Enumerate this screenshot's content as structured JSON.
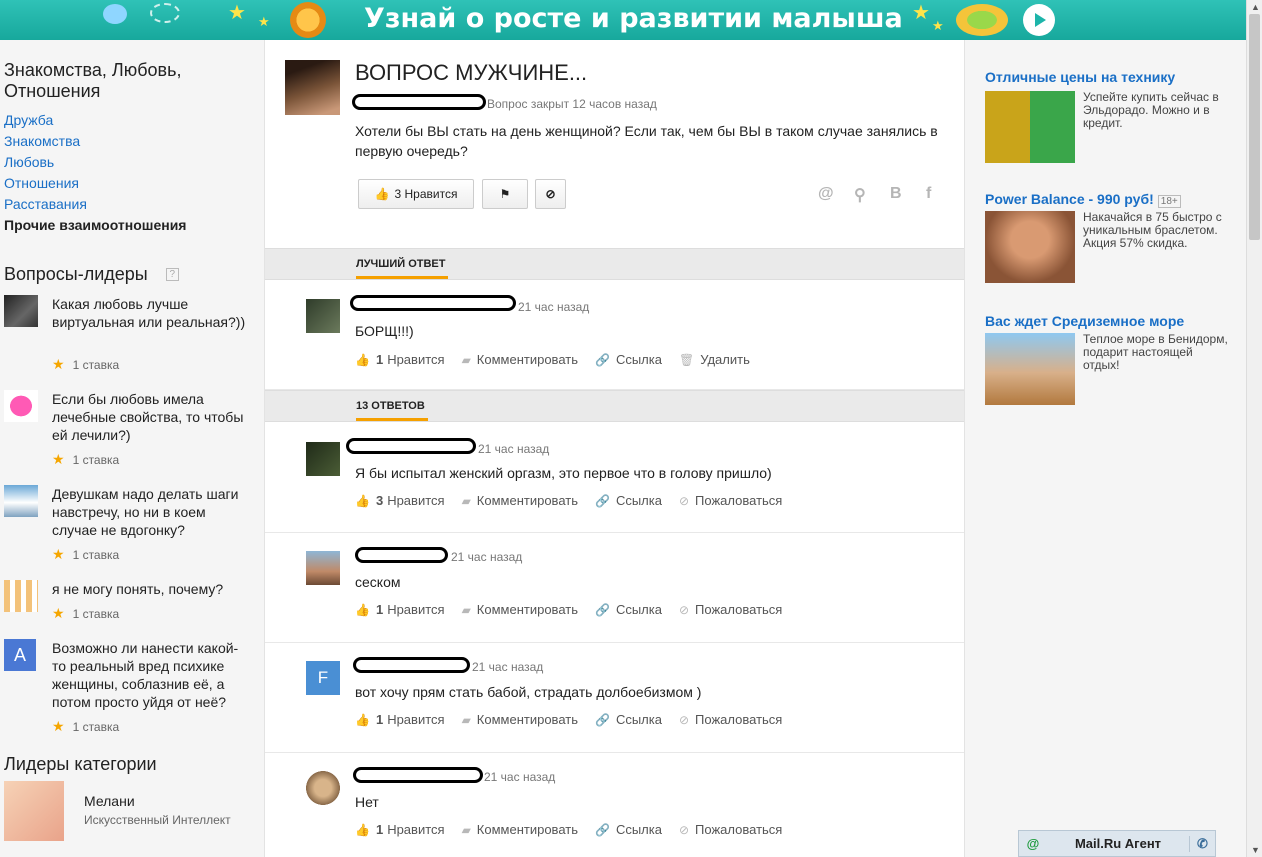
{
  "banner": {
    "title": "Узнай о росте и развитии малыша"
  },
  "sidebar": {
    "category_title": "Знакомства, Любовь, Отношения",
    "links": [
      {
        "label": "Дружба"
      },
      {
        "label": "Знакомства"
      },
      {
        "label": "Любовь"
      },
      {
        "label": "Отношения"
      },
      {
        "label": "Расставания"
      },
      {
        "label": "Прочие взаимоотношения"
      }
    ],
    "leaders_q_title": "Вопросы-лидеры",
    "help": "?",
    "leader_questions": [
      {
        "text": "Какая любовь лучше виртуальная или реальная?))",
        "stake": "1 ставка"
      },
      {
        "text": "Если бы любовь имела лечебные свойства, то чтобы ей лечили?)",
        "stake": "1 ставка"
      },
      {
        "text": "Девушкам надо делать шаги навстречу, но ни в коем случае не вдогонку?",
        "stake": "1 ставка"
      },
      {
        "text": "я не могу понять, почему?",
        "stake": "1 ставка"
      },
      {
        "text": "Возможно ли нанести какой-то реальный вред психике женщины, соблазнив её, а потом просто уйдя от неё?",
        "stake": "1 ставка",
        "avatar_letter": "A"
      }
    ],
    "leaders_title": "Лидеры категории",
    "leader": {
      "name": "Мелани",
      "role": "Искусственный Интеллект"
    }
  },
  "question": {
    "title": "ВОПРОС МУЖЧИНЕ...",
    "meta": "Вопрос закрыт 12 часов назад",
    "text": "Хотели бы ВЫ стать на день женщиной? Если так, чем бы ВЫ в таком случае занялись в первую очередь?",
    "like_label": "3 Нравится",
    "share_icons": [
      "@",
      "ok",
      "B",
      "f"
    ]
  },
  "best_answer": {
    "section_label": "ЛУЧШИЙ ОТВЕТ",
    "time": "21 час назад",
    "text": "БОРЩ!!!)",
    "likes": "1",
    "like_label": "Нравится",
    "comment_label": "Комментировать",
    "link_label": "Ссылка",
    "delete_label": "Удалить"
  },
  "answers_section": {
    "label": "13 ОТВЕТОВ"
  },
  "answers": [
    {
      "time": "21 час назад",
      "text": "Я бы испытал женский оргазм, это первое что в голову пришло)",
      "likes": "3",
      "like_label": "Нравится",
      "comment_label": "Комментировать",
      "link_label": "Ссылка",
      "report_label": "Пожаловаться"
    },
    {
      "time": "21 час назад",
      "text": "сеском",
      "likes": "1",
      "like_label": "Нравится",
      "comment_label": "Комментировать",
      "link_label": "Ссылка",
      "report_label": "Пожаловаться"
    },
    {
      "time": "21 час назад",
      "text": "вот хочу прям стать бабой, страдать долбоебизмом )",
      "likes": "1",
      "like_label": "Нравится",
      "comment_label": "Комментировать",
      "link_label": "Ссылка",
      "report_label": "Пожаловаться",
      "avatar_letter": "F"
    },
    {
      "time": "21 час назад",
      "text": "Нет",
      "likes": "1",
      "like_label": "Нравится",
      "comment_label": "Комментировать",
      "link_label": "Ссылка",
      "report_label": "Пожаловаться"
    }
  ],
  "ads": [
    {
      "title": "Отличные цены на технику",
      "desc": "Успейте купить сейчас в Эльдорадо. Можно и в кредит."
    },
    {
      "title": "Power Balance - 990 руб!",
      "badge": "18+",
      "desc": "Накачайся в 75 быстро с уникальным браслетом. Акция 57% скидка."
    },
    {
      "title": "Вас ждет Средиземное море",
      "desc": "Теплое море в Бенидорм, подарит настоящей отдых!"
    }
  ],
  "agent": {
    "label": "Mail.Ru Агент"
  },
  "colors": {
    "link": "#1a6fc6",
    "accent": "#f5a000",
    "banner": "#1db5aa"
  }
}
